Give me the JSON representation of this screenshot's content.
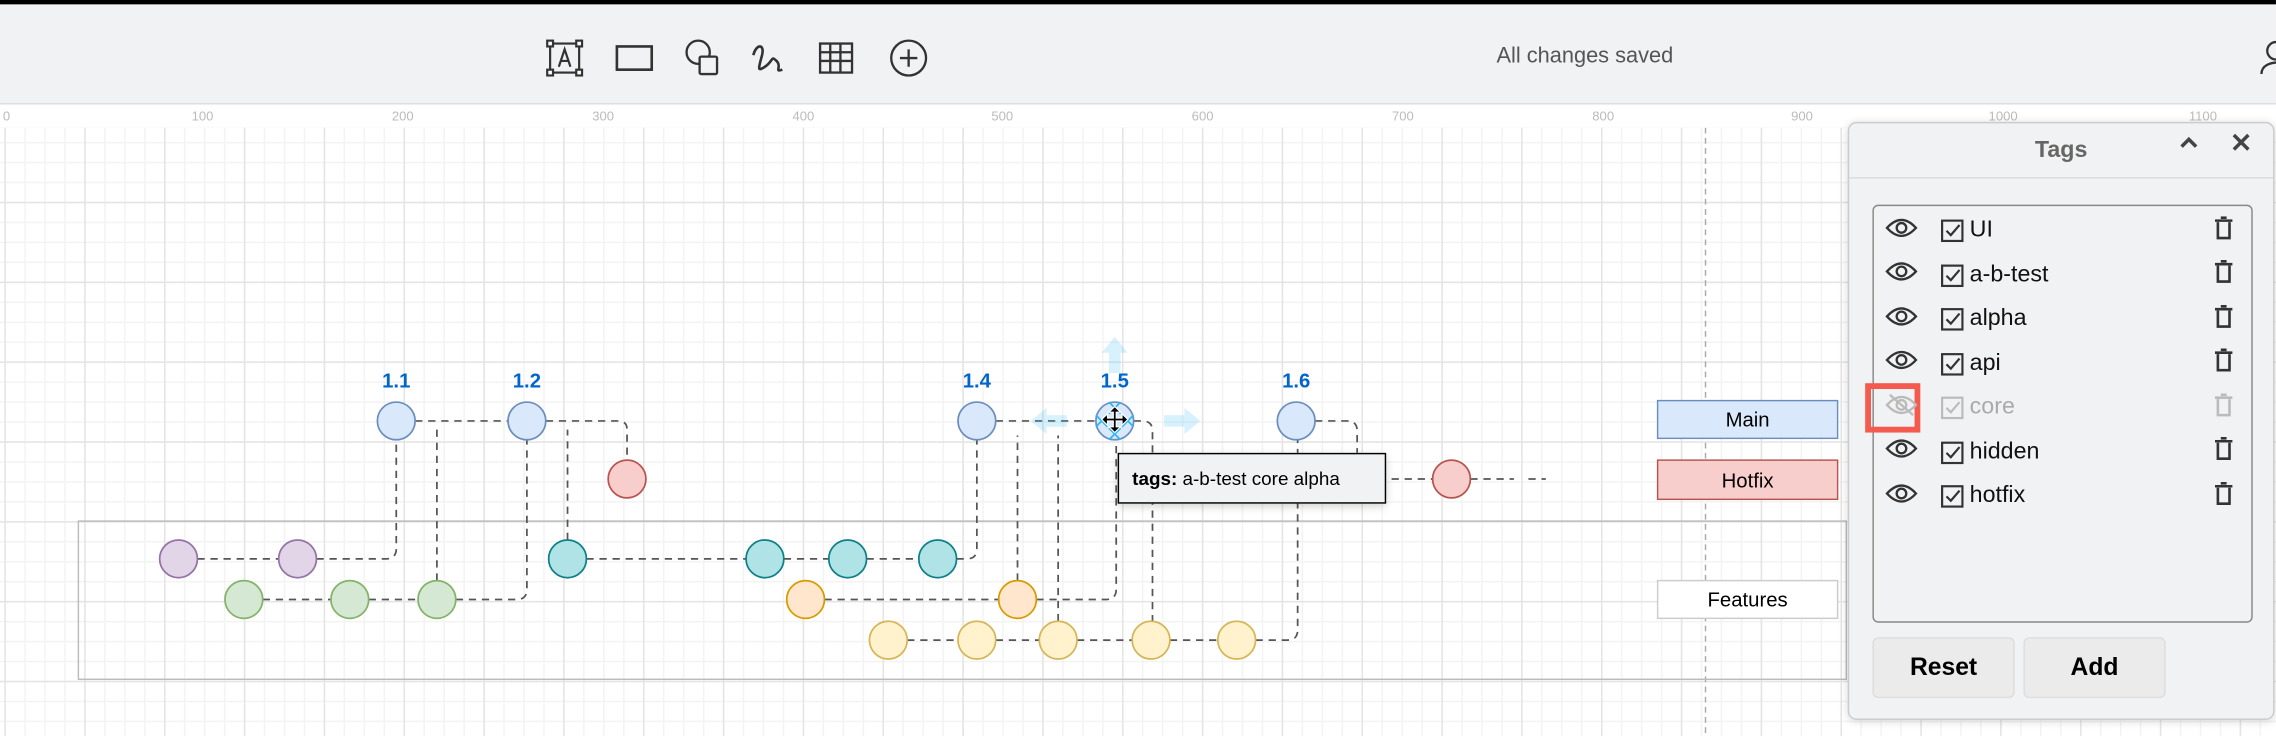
{
  "toolbar": {
    "tools": [
      "text-icon",
      "rectangle-icon",
      "shapes-icon",
      "freehand-icon",
      "table-icon",
      "insert-icon"
    ],
    "status": "All changes saved"
  },
  "ruler": {
    "labels": [
      "0",
      "100",
      "200",
      "300",
      "400",
      "500",
      "600",
      "700",
      "800",
      "900",
      "1000",
      "1100"
    ]
  },
  "diagram": {
    "versions": [
      "1.1",
      "1.2",
      "1.4",
      "1.5",
      "1.6"
    ],
    "legend": {
      "main": "Main",
      "hotfix": "Hotfix",
      "features": "Features"
    },
    "tooltip": {
      "key": "tags:",
      "value": "a-b-test core alpha"
    },
    "colors": {
      "main": "#dae8fc",
      "hotfix": "#f8cecc",
      "purple": "#e1d5e7",
      "green": "#d5e8d4",
      "teal": "#b0e3e6",
      "orange": "#ffe6cc",
      "yellow": "#fff2cc",
      "selection": "#29b6f2"
    }
  },
  "tags_panel": {
    "title": "Tags",
    "items": [
      {
        "name": "UI",
        "visible": true,
        "checked": true
      },
      {
        "name": "a-b-test",
        "visible": true,
        "checked": true
      },
      {
        "name": "alpha",
        "visible": true,
        "checked": true
      },
      {
        "name": "api",
        "visible": true,
        "checked": true
      },
      {
        "name": "core",
        "visible": false,
        "checked": true
      },
      {
        "name": "hidden",
        "visible": true,
        "checked": true
      },
      {
        "name": "hotfix",
        "visible": true,
        "checked": true
      }
    ],
    "reset_label": "Reset",
    "add_label": "Add"
  }
}
